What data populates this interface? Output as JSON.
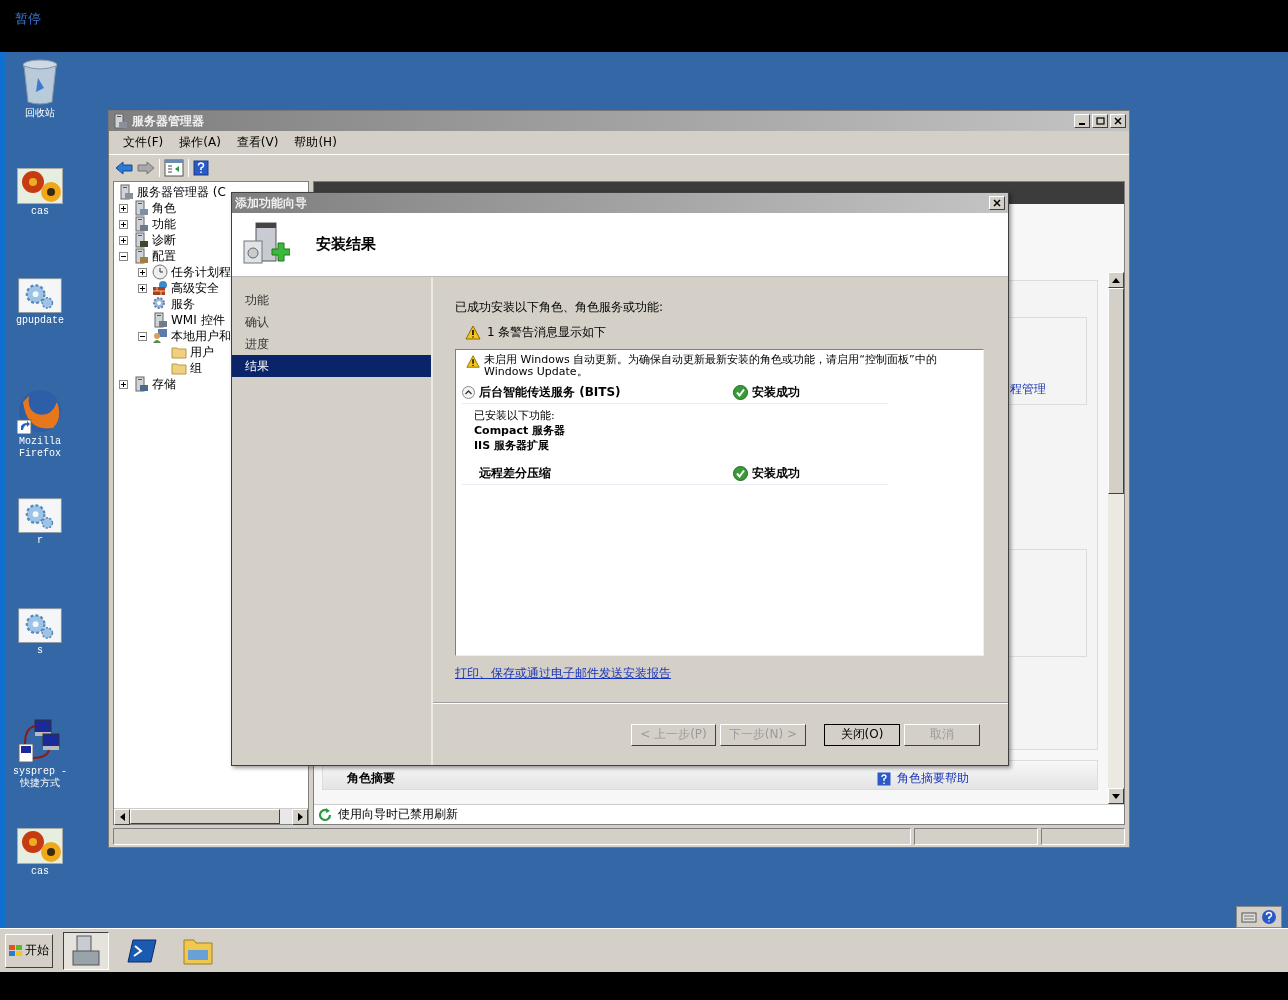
{
  "top_bar": {
    "status": "暂停"
  },
  "taskbar": {
    "start": "开始"
  },
  "desktop_icons": [
    {
      "label": "回收站",
      "kind": "recycle"
    },
    {
      "label": "cas",
      "kind": "image"
    },
    {
      "label": "gpupdate",
      "kind": "script"
    },
    {
      "label": "Mozilla Firefox",
      "kind": "browser"
    },
    {
      "label": "r",
      "kind": "script"
    },
    {
      "label": "s",
      "kind": "script"
    },
    {
      "label": "sysprep - 快捷方式",
      "kind": "network"
    },
    {
      "label": "cas",
      "kind": "image"
    }
  ],
  "server_manager": {
    "title": "服务器管理器",
    "menu": [
      "文件(F)",
      "操作(A)",
      "查看(V)",
      "帮助(H)"
    ],
    "tree": {
      "label": "服务器管理器 (C",
      "kind": "server",
      "children": [
        {
          "label": "角色",
          "kind": "roles",
          "expanded": false
        },
        {
          "label": "功能",
          "kind": "features",
          "expanded": false
        },
        {
          "label": "诊断",
          "kind": "diagnostics",
          "expanded": false
        },
        {
          "label": "配置",
          "kind": "config",
          "expanded": true,
          "children": [
            {
              "label": "任务计划程",
              "kind": "clock",
              "expanded": false
            },
            {
              "label": "高级安全",
              "kind": "firewall",
              "expanded": false
            },
            {
              "label": "服务",
              "kind": "services"
            },
            {
              "label": "WMI 控件",
              "kind": "wmi"
            },
            {
              "label": "本地用户和",
              "kind": "users",
              "expanded": true,
              "children": [
                {
                  "label": "用户",
                  "kind": "folder"
                },
                {
                  "label": "组",
                  "kind": "folder"
                }
              ]
            }
          ]
        },
        {
          "label": "存储",
          "kind": "storage",
          "expanded": false
        }
      ]
    },
    "panel_link": "程管理",
    "section_title": "角色摘要",
    "help_link": "角色摘要帮助",
    "status": "使用向导时已禁用刷新"
  },
  "wizard": {
    "title": "添加功能向导",
    "heading": "安装结果",
    "nav": [
      {
        "label": "功能",
        "selected": false
      },
      {
        "label": "确认",
        "selected": false
      },
      {
        "label": "进度",
        "selected": false
      },
      {
        "label": "结果",
        "selected": true
      }
    ],
    "intro": "已成功安装以下角色、角色服务或功能:",
    "warning_count": "1 条警告消息显示如下",
    "warning": "未启用 Windows 自动更新。为确保自动更新最新安装的角色或功能，请启用“控制面板”中的 Windows Update。",
    "results": [
      {
        "name": "后台智能传送服务 (BITS)",
        "status": "安装成功",
        "expanded": true,
        "details": [
          {
            "text": "已安装以下功能:",
            "kind": "note"
          },
          {
            "text": "Compact 服务器",
            "kind": "feature"
          },
          {
            "text": "IIS 服务器扩展",
            "kind": "feature"
          }
        ]
      },
      {
        "name": "远程差分压缩",
        "status": "安装成功"
      }
    ],
    "report_link": "打印、保存或通过电子邮件发送安装报告",
    "buttons": [
      {
        "label": "< 上一步(P)",
        "disabled": true
      },
      {
        "label": "下一步(N) >",
        "disabled": true
      },
      {
        "label": "关闭(O)",
        "disabled": false
      },
      {
        "label": "取消",
        "disabled": true
      }
    ]
  }
}
